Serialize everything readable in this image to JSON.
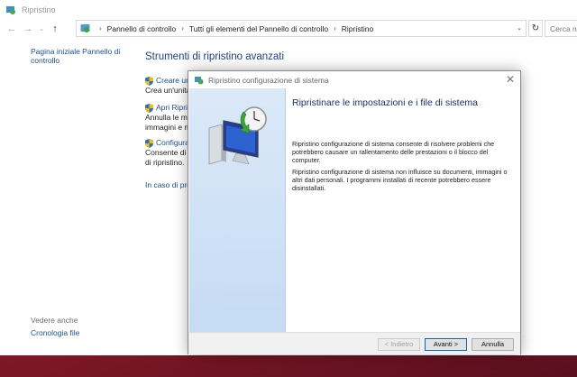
{
  "window": {
    "title": "Ripristino",
    "search_placeholder": "Cerca n"
  },
  "addressbar": {
    "crumbs": [
      "Pannello di controllo",
      "Tutti gli elementi del Pannello di controllo",
      "Ripristino"
    ]
  },
  "sidebar": {
    "home_link": "Pagina iniziale Pannello di controllo",
    "see_also_label": "Vedere anche",
    "file_history_link": "Cronologia file"
  },
  "main": {
    "title": "Strumenti di ripristino avanzati",
    "items": [
      {
        "link": "Creare un'",
        "desc": "Crea un'unità"
      },
      {
        "link": "Apri Ripris",
        "desc_lines": [
          "Annulla le mo",
          "immagini e m"
        ]
      },
      {
        "link": "Configura",
        "desc_lines": [
          "Consente di n",
          "di ripristino."
        ]
      }
    ],
    "help_link": "In caso di prob"
  },
  "dialog": {
    "title": "Ripristino configurazione di sistema",
    "heading": "Ripristinare le impostazioni e i file di sistema",
    "paragraph1": "Ripristino configurazione di sistema consente di risolvere problemi che potrebbero causare un rallentamento delle prestazioni o il blocco del computer.",
    "paragraph2": "Ripristino configurazione di sistema non influisce su documenti, immagini o altri dati personali. I programmi installati di recente potrebbero essere disinstallati.",
    "buttons": {
      "back": "< Indietro",
      "next": "Avanti >",
      "cancel": "Annulla"
    }
  },
  "colors": {
    "link": "#1a4f9e",
    "title_blue": "#1e3f8a",
    "desktop_accent": "#c8323c"
  }
}
